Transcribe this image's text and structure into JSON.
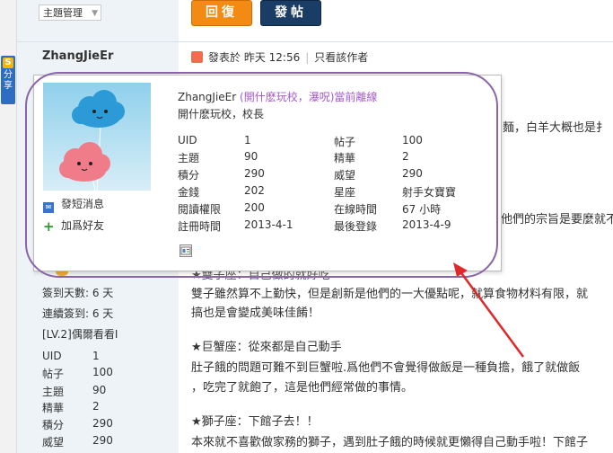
{
  "toolbar": {
    "manage_label": "主題管理",
    "reply_label": "回復",
    "post_label": "發帖"
  },
  "share_tab": {
    "icon_letter": "S",
    "label": "分享"
  },
  "author": {
    "name": "ZhangJieEr"
  },
  "post_header": {
    "posted_label": "發表於 昨天 12:56",
    "only_author": "只看該作者"
  },
  "card": {
    "username": "ZhangJieEr",
    "tagline": "(開什麽玩校，瀑呪)當前離線",
    "title": "開什麽玩校，校長",
    "stats_left": [
      {
        "label": "UID",
        "value": "1"
      },
      {
        "label": "主題",
        "value": "90"
      },
      {
        "label": "積分",
        "value": "290"
      },
      {
        "label": "金錢",
        "value": "202"
      },
      {
        "label": "閱讀權限",
        "value": "200"
      },
      {
        "label": "註冊時間",
        "value": "2013-4-1"
      }
    ],
    "stats_right": [
      {
        "label": "帖子",
        "value": "100"
      },
      {
        "label": "精華",
        "value": "2"
      },
      {
        "label": "威望",
        "value": "290"
      },
      {
        "label": "星座",
        "value": "射手女寶寶"
      },
      {
        "label": "在線時間",
        "value": "67 小時"
      },
      {
        "label": "最後登錄",
        "value": "2013-4-9"
      }
    ],
    "send_pm": "發短消息",
    "add_friend": "加爲好友"
  },
  "sidebar_stats": {
    "checkin_days": "簽到天數: 6 天",
    "streak_days": "連續簽到: 6 天",
    "level": "[LV.2]偶爾看看I",
    "rows": [
      {
        "label": "UID",
        "value": "1"
      },
      {
        "label": "帖子",
        "value": "100"
      },
      {
        "label": "主題",
        "value": "90"
      },
      {
        "label": "精華",
        "value": "2"
      },
      {
        "label": "積分",
        "value": "290"
      },
      {
        "label": "威望",
        "value": "290"
      }
    ]
  },
  "post_body": {
    "frag_right1": "麵，白羊大概也是扌",
    "frag_right2": "他們的宗旨是要麼就不",
    "partial_heading": "★雙子座：自己做的就好吃",
    "lines": [
      "雙子雖然算不上勤快，但是創新是他們的一大優點呢，就算食物材料有限，就",
      "搞也是會變成美味佳餚！",
      "★巨蟹座：從來都是自己動手",
      "肚子餓的問題可難不到巨蟹啦.爲他們不會覺得做飯是一種負擔，餓了就做飯",
      "，吃完了就飽了，這是他們經常做的事情。",
      "★獅子座：下館子去！！",
      "本來就不喜歡做家務的獅子，遇到肚子餓的時候就更懶得自己動手啦！下館子"
    ]
  },
  "colors": {
    "reply_button": "#f28a14",
    "post_button": "#1a3d66",
    "annotation_ring": "#8a64a8",
    "annotation_arrow": "#e0282a",
    "tagline": "#a45cc9"
  }
}
